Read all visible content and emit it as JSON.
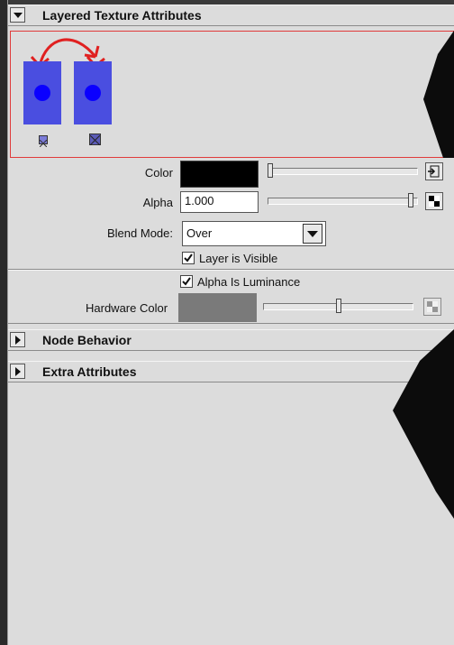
{
  "layered_texture": {
    "title": "Layered Texture Attributes"
  },
  "attributes": {
    "color_label": "Color",
    "color_value": "#000000",
    "alpha_label": "Alpha",
    "alpha_value": "1.000",
    "blend_mode_label": "Blend Mode:",
    "blend_mode_value": "Over",
    "layer_visible_label": "Layer is Visible",
    "alpha_is_luminance_label": "Alpha Is Luminance",
    "hardware_color_label": "Hardware Color",
    "hardware_color_value": "#7a7a7a"
  },
  "sections": {
    "node_behavior": "Node Behavior",
    "extra_attributes": "Extra Attributes"
  },
  "colors": {
    "layer_swatch": "#4a4ee0",
    "swatch_dot": "#0a00ff",
    "panel_border": "#e03b3b",
    "annotation_arrow": "#e02020"
  }
}
